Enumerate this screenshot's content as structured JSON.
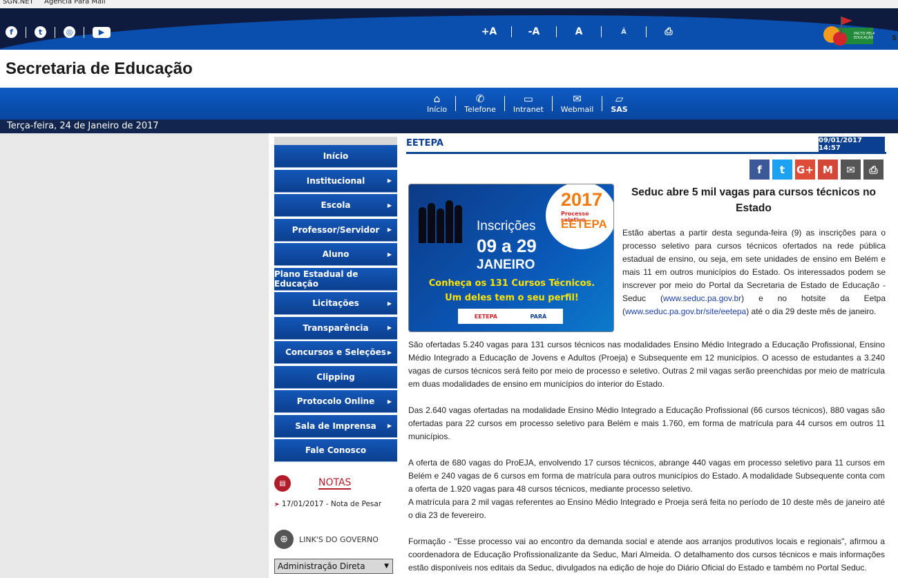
{
  "bookmarks": [
    {
      "label": "SGN.NET"
    },
    {
      "label": "Agência Pará Mail"
    }
  ],
  "accessibility": {
    "increase": "+A",
    "decrease": "-A",
    "normal": "A",
    "contrast": "A",
    "print": "print"
  },
  "site_title": "Secretaria de Educação",
  "nav": [
    {
      "label": "Início",
      "icon": "home-icon"
    },
    {
      "label": "Telefone",
      "icon": "phone-icon"
    },
    {
      "label": "Intranet",
      "icon": "monitor-icon"
    },
    {
      "label": "Webmail",
      "icon": "mail-icon"
    },
    {
      "label": "SAS",
      "icon": "chat-icon"
    }
  ],
  "date_text": "Terça-feira, 24 de Janeiro de 2017",
  "side_menu": [
    {
      "label": "Início",
      "submenu": false
    },
    {
      "label": "Institucional",
      "submenu": true
    },
    {
      "label": "Escola",
      "submenu": true
    },
    {
      "label": "Professor/Servidor",
      "submenu": true
    },
    {
      "label": "Aluno",
      "submenu": true
    },
    {
      "label": "Plano Estadual de Educação",
      "submenu": false
    },
    {
      "label": "Licitações",
      "submenu": true
    },
    {
      "label": "Transparência",
      "submenu": true
    },
    {
      "label": "Concursos e Seleções",
      "submenu": true
    },
    {
      "label": "Clipping",
      "submenu": false
    },
    {
      "label": "Protocolo Online",
      "submenu": true
    },
    {
      "label": "Sala de Imprensa",
      "submenu": true
    },
    {
      "label": "Fale Conosco",
      "submenu": false
    }
  ],
  "notas": {
    "title": "NOTAS",
    "item": "17/01/2017 - Nota de Pesar"
  },
  "links_gov": {
    "title": "LINK'S DO GOVERNO",
    "selected": "Administração Direta"
  },
  "section": "EETEPA",
  "timestamp": "09/01/2017 14:57",
  "share": [
    {
      "icon": "facebook-icon",
      "glyph": "f",
      "color": "#3b5998"
    },
    {
      "icon": "twitter-icon",
      "glyph": "t",
      "color": "#1da1f2"
    },
    {
      "icon": "google-plus-icon",
      "glyph": "G+",
      "color": "#dd4b39"
    },
    {
      "icon": "gmail-icon",
      "glyph": "M",
      "color": "#d44638"
    },
    {
      "icon": "email-icon",
      "glyph": "✉",
      "color": "#555555"
    },
    {
      "icon": "print-icon",
      "glyph": "⎙",
      "color": "#555555"
    }
  ],
  "banner": {
    "year": "2017",
    "process": "Processo seletivo",
    "brand": "EETEPA",
    "inscricoes": "Inscrições",
    "dias": "09 a 29",
    "mes": "JANEIRO",
    "line1": "Conheça os 131 Cursos Técnicos.",
    "line2": "Um deles tem o seu perfil!",
    "footer_left": "EETEPA",
    "footer_right": "PARÁ"
  },
  "headline": "Seduc abre 5 mil vagas para cursos técnicos no Estado",
  "intro": {
    "p1": "Estão abertas a partir desta segunda-feira (9) as inscrições para o processo seletivo para cursos técnicos ofertados na rede pública estadual de ensino, ou seja, em sete unidades de ensino em Belém e mais 11 em outros municípios do Estado. Os interessados podem se inscrever por meio do Portal da Secretaria de Estado de Educação - Seduc (",
    "link1": "www.seduc.pa.gov.br",
    "p2": ") e no hotsite da Eetpa (",
    "link2": "www.seduc.pa.gov.br/site/eetepa",
    "p3": ") até o dia 29 deste mês de janeiro."
  },
  "body": [
    "São ofertadas 5.240 vagas para 131 cursos técnicos nas modalidades Ensino Médio Integrado a Educação Profissional, Ensino Médio Integrado a Educação de Jovens e Adultos (Proeja) e Subsequente em 12 municípios. O acesso de estudantes a 3.240 vagas de cursos técnicos será feito por meio de processo e seletivo. Outras 2 mil vagas serão preenchidas por meio de matrícula em duas modalidades de ensino em municípios do interior do Estado.",
    "Das 2.640 vagas ofertadas na modalidade Ensino Médio Integrado a Educação Profissional (66 cursos técnicos), 880 vagas são ofertadas para 22 cursos em processo seletivo para Belém e mais 1.760, em forma de matrícula para 44 cursos em outros 11 municípios.",
    "A oferta de 680 vagas do ProEJA, envolvendo 17 cursos técnicos, abrange 440 vagas em processo seletivo para 11 cursos em Belém e 240 vagas de 6 cursos em forma de matrícula para outros municípios do Estado. A modalidade Subsequente conta com a oferta de 1.920 vagas para 48 cursos técnicos, mediante processo seletivo.",
    "A matrícula para 2 mil vagas referentes ao Ensino Médio Integrado e Proeja será feita no período de 10 deste mês de janeiro até o dia 23 de fevereiro.",
    "Formação - \"Esse processo vai ao encontro da demanda social e atende aos arranjos produtivos locais e regionais\", afirmou a coordenadora de Educação Profissionalizante da Seduc, Mari Almeida. O detalhamento dos cursos técnicos e mais informações estão disponíveis nos editais da Seduc, divulgados na edição de hoje do Diário Oficial do Estado e também no Portal Seduc."
  ]
}
